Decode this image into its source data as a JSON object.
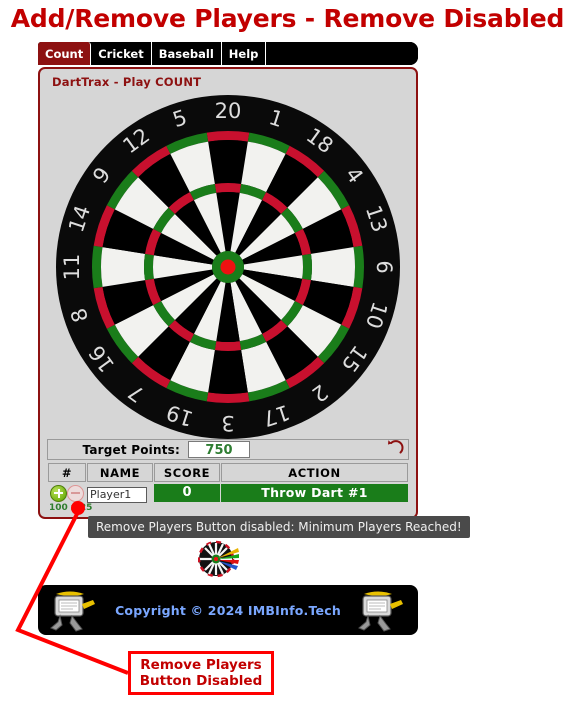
{
  "page": {
    "title": "Add/Remove Players - Remove Disabled",
    "title_color": "#c20000"
  },
  "tabs": [
    {
      "label": "Count",
      "active": true
    },
    {
      "label": "Cricket",
      "active": false
    },
    {
      "label": "Baseball",
      "active": false
    },
    {
      "label": "Help",
      "active": false
    }
  ],
  "panel": {
    "title": "DartTrax - Play COUNT",
    "border_color": "#8d1111",
    "background": "#d6d6d6"
  },
  "dartboard": {
    "numbers": [
      20,
      1,
      18,
      4,
      13,
      6,
      10,
      15,
      2,
      17,
      3,
      19,
      7,
      16,
      8,
      11,
      14,
      9,
      12,
      5
    ],
    "ring_colors": [
      "#c8102e",
      "#1a7d1a"
    ],
    "bed_colors": [
      "#000000",
      "#f2f2ef"
    ],
    "bull_outer": "#1a7d1a",
    "bull_inner": "#ee1111",
    "number_color": "#dddddd"
  },
  "target": {
    "label": "Target Points:",
    "value": "750",
    "value_color": "#2e7d32",
    "undo_icon": "undo-arrow-icon"
  },
  "table": {
    "headers": [
      "#",
      "NAME",
      "SCORE",
      "ACTION"
    ],
    "rows": [
      {
        "add_icon": "add-player-icon",
        "remove_icon": "remove-player-icon",
        "name": "Player1",
        "name_placeholder": "Player1",
        "score": "0",
        "action": "Throw Dart #1",
        "action_color": "#1a7d1a"
      }
    ]
  },
  "size_hint": "100 x 25",
  "tooltip": {
    "text": "Remove Players Button disabled: Minimum Players Reached!",
    "background": "#4a4a4a"
  },
  "mini_dart_icon": "dartboard-with-darts-icon",
  "footer": {
    "copyright": "Copyright © 2024 IMBInfo.Tech",
    "text_color": "#7aa7ff",
    "left_icon": "running-computer-icon",
    "right_icon": "running-computer-icon"
  },
  "annotation": {
    "line1": "Remove Players",
    "line2": "Button Disabled",
    "color": "#c20000",
    "border_color": "#ff0000"
  }
}
